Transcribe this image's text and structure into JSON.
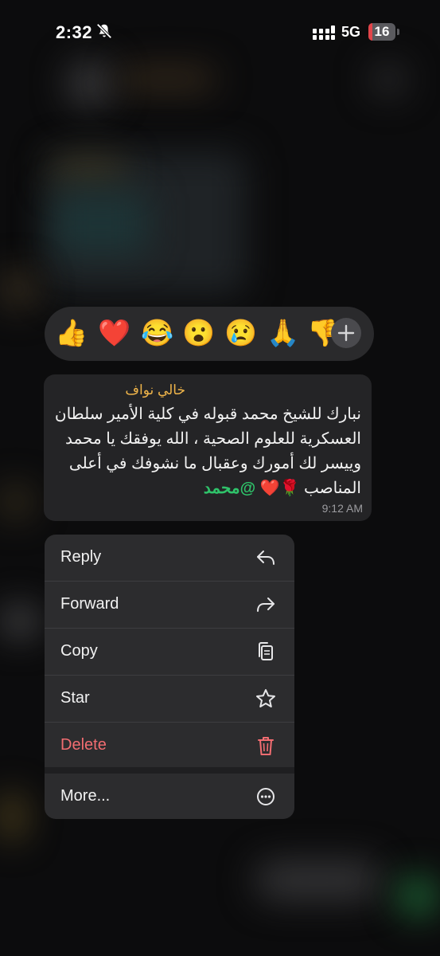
{
  "status_bar": {
    "time": "2:32",
    "network": "5G",
    "battery": "16",
    "battery_level_percent": 16,
    "icons": [
      "bell-slash-icon",
      "signal-icon"
    ]
  },
  "reactions": {
    "emojis": [
      "👍",
      "❤️",
      "😂",
      "😮",
      "😢",
      "🙏",
      "👎"
    ],
    "add_icon": "plus-icon"
  },
  "message": {
    "sender": "خالي نواف",
    "text": "نبارك للشيخ محمد قبوله في كلية الأمير سلطان العسكرية للعلوم الصحية ، الله يوفقك يا محمد وييسر لك أمورك وعقبال ما نشوفك في أعلى المناصب 🌹❤️ ",
    "mention": "@محمد",
    "time": "9:12 AM"
  },
  "menu": {
    "items": [
      {
        "label": "Reply",
        "icon": "reply-icon"
      },
      {
        "label": "Forward",
        "icon": "forward-icon"
      },
      {
        "label": "Copy",
        "icon": "copy-icon"
      },
      {
        "label": "Star",
        "icon": "star-icon"
      },
      {
        "label": "Delete",
        "icon": "trash-icon"
      },
      {
        "label": "More...",
        "icon": "more-icon"
      }
    ]
  },
  "colors": {
    "sender": "#f0b54a",
    "mention": "#2fc36a",
    "delete": "#f26d71",
    "menu_bg": "#2c2c2e",
    "battery_low": "#e2454a"
  }
}
